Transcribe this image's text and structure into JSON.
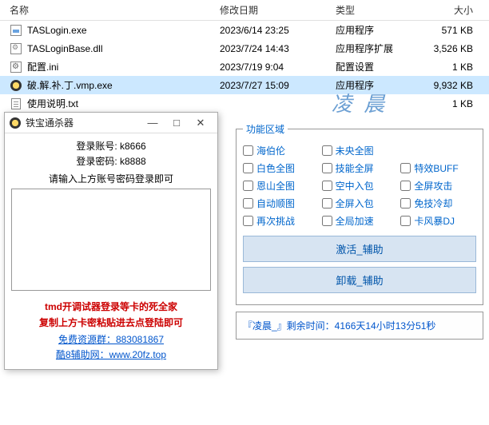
{
  "explorer": {
    "headers": {
      "name": "名称",
      "date": "修改日期",
      "type": "类型",
      "size": "大小"
    },
    "files": [
      {
        "name": "TASLogin.exe",
        "date": "2023/6/14 23:25",
        "type": "应用程序",
        "size": "571 KB",
        "icon": "exe"
      },
      {
        "name": "TASLoginBase.dll",
        "date": "2023/7/24 14:43",
        "type": "应用程序扩展",
        "size": "3,526 KB",
        "icon": "dll"
      },
      {
        "name": "配置.ini",
        "date": "2023/7/19 9:04",
        "type": "配置设置",
        "size": "1 KB",
        "icon": "ini"
      },
      {
        "name": "破.解.补.丁.vmp.exe",
        "date": "2023/7/27 15:09",
        "type": "应用程序",
        "size": "9,932 KB",
        "icon": "vmp",
        "selected": true
      },
      {
        "name": "使用说明.txt",
        "date": "",
        "type": "",
        "size": "1 KB",
        "icon": "txt"
      }
    ]
  },
  "login": {
    "title": "铁宝通杀器",
    "account_label": "登录账号: ",
    "account_value": "k8666",
    "password_label": "登录密码: ",
    "password_value": "k8888",
    "hint": "请输入上方账号密码登录即可",
    "red1": "tmd开调试器登录等卡的死全家",
    "red2": "复制上方卡密粘贴进去点登陆即可",
    "blue1": "免费资源群：883081867",
    "blue2": "酷8辅助网：www.20fz.top"
  },
  "cheat": {
    "title": "凌 晨",
    "legend": "功能区域",
    "grid": [
      [
        "海伯伦",
        "未央全图",
        ""
      ],
      [
        "白色全图",
        "技能全屏",
        "特效BUFF"
      ],
      [
        "恩山全图",
        "空中入包",
        "全屏攻击"
      ],
      [
        "自动顺图",
        "全屏入包",
        "免技冷却"
      ],
      [
        "再次挑战",
        "全局加速",
        "卡风暴DJ"
      ]
    ],
    "btn_activate": "激活_辅助",
    "btn_unload": "卸载_辅助",
    "status": "『凌晨_』剩余时间：4166天14小时13分51秒"
  }
}
